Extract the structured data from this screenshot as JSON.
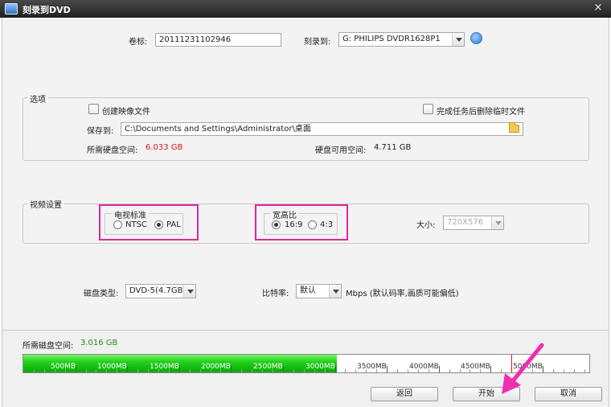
{
  "window": {
    "title": "刻录到DVD",
    "close_glyph": "×"
  },
  "header": {
    "volume_label": "卷标:",
    "volume_value": "20111231102946",
    "burn_to_label": "刻录到:",
    "burn_to_value": "G: PHILIPS  DVDR1628P1"
  },
  "options": {
    "group_title": "选项",
    "create_image_label": "创建映像文件",
    "delete_temp_label": "完成任务后删除临时文件",
    "save_to_label": "保存到:",
    "save_to_value": "C:\\Documents and Settings\\Administrator\\桌面",
    "required_space_label": "所需硬盘空间:",
    "required_space_value": "6.033 GB",
    "available_space_label": "硬盘可用空间:",
    "available_space_value": "4.711 GB"
  },
  "video": {
    "group_title": "视频设置",
    "tv_standard_title": "电视标准",
    "ntsc_label": "NTSC",
    "pal_label": "PAL",
    "aspect_title": "宽高比",
    "aspect_169_label": "16:9",
    "aspect_43_label": "4:3",
    "size_label": "大小:",
    "size_value": "720X576"
  },
  "disc": {
    "type_label": "磁盘类型:",
    "type_value": "DVD-5(4.7GB)",
    "bitrate_label": "比特率:",
    "bitrate_value": "默认",
    "bitrate_note": "Mbps (默认码率,画质可能偏低)"
  },
  "capacity": {
    "label": "所需磁盘空间:",
    "value": "3.016 GB",
    "filled_mb": 3016,
    "limit_mb": 4700,
    "scale_max_mb": 5450,
    "ticks": [
      {
        "mb": 500,
        "label": "500MB"
      },
      {
        "mb": 1000,
        "label": "1000MB"
      },
      {
        "mb": 1500,
        "label": "1500MB"
      },
      {
        "mb": 2000,
        "label": "2000MB"
      },
      {
        "mb": 2500,
        "label": "2500MB"
      },
      {
        "mb": 3000,
        "label": "3000MB"
      },
      {
        "mb": 3500,
        "label": "3500MB"
      },
      {
        "mb": 4000,
        "label": "4000MB"
      },
      {
        "mb": 4500,
        "label": "4500MB"
      },
      {
        "mb": 5000,
        "label": "5000MB"
      }
    ]
  },
  "buttons": {
    "back": "返回",
    "start": "开始",
    "cancel": "取消"
  },
  "colors": {
    "accent_highlight": "#e0259e",
    "fill": "#22d11b",
    "warning": "#e0171e",
    "ok": "#2c8a1f"
  }
}
